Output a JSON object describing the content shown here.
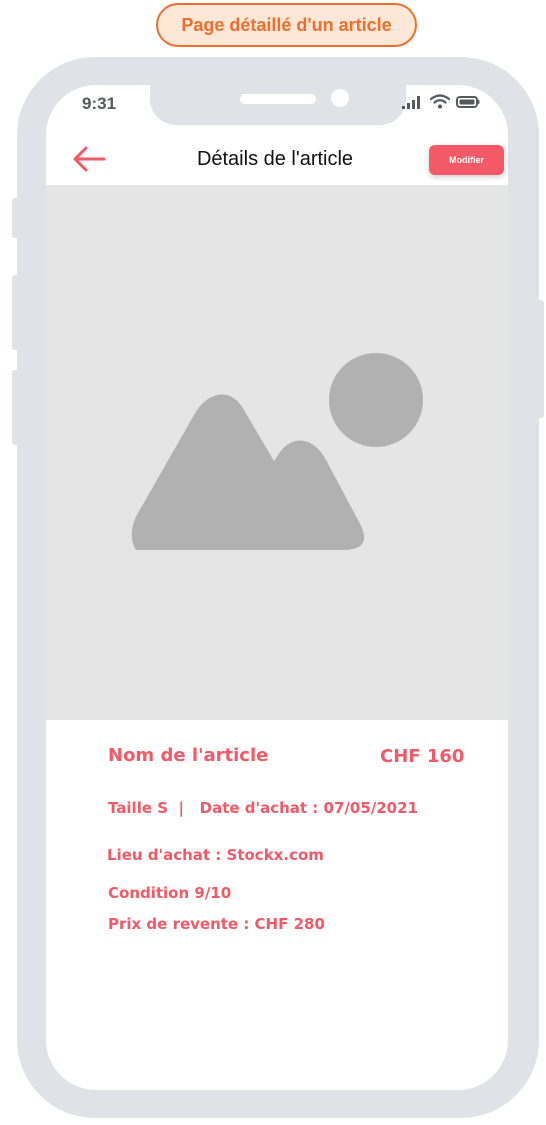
{
  "page_label": "Page détaillé d'un article",
  "status_bar": {
    "time": "9:31",
    "icons": [
      "signal-icon",
      "wifi-icon",
      "battery-icon"
    ]
  },
  "header": {
    "title": "Détails de l'article",
    "back_icon": "arrow-left-icon",
    "modify_label": "Modifier"
  },
  "image": {
    "placeholder_icon": "image-placeholder-icon"
  },
  "article": {
    "name": "Nom de l'article",
    "price": "CHF 160",
    "size_and_date": "Taille S  |   Date d'achat : 07/05/2021",
    "purchase_place": "Lieu d'achat : Stockx.com",
    "condition": "Condition 9/10",
    "resale_price": "Prix de revente : CHF 280"
  },
  "colors": {
    "accent": "#f15a66",
    "label_orange": "#ee6f2d",
    "frame": "#dfe2e6",
    "placeholder_bg": "#e5e5e5",
    "placeholder_shape": "#b1b1b1"
  }
}
